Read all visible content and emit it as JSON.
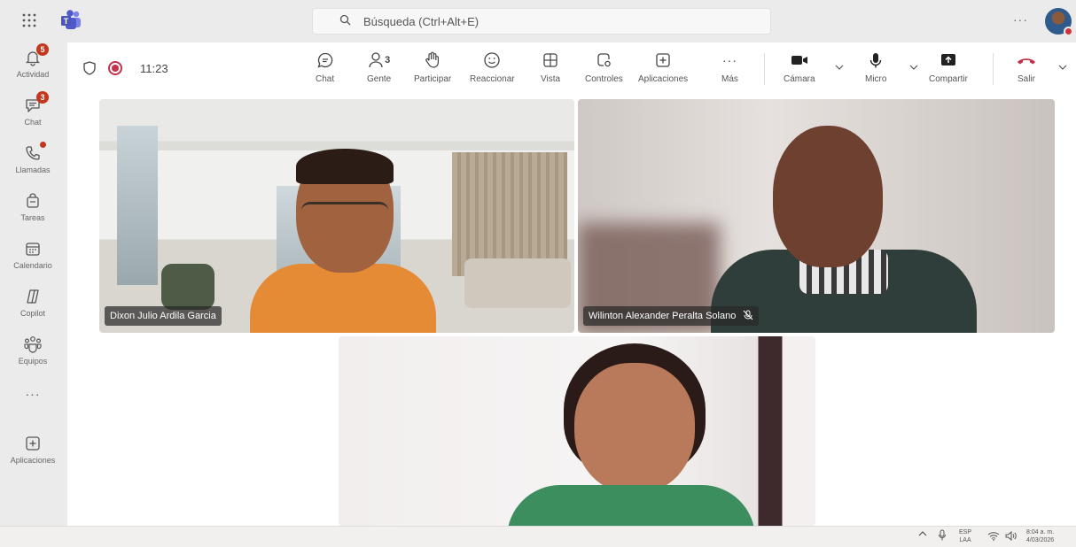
{
  "topbar": {
    "search_placeholder": "Búsqueda (Ctrl+Alt+E)",
    "more": "···",
    "icons": [
      "app-grid-icon",
      "teams-logo-icon",
      "search-icon"
    ]
  },
  "rail": {
    "items": [
      {
        "label": "Actividad",
        "badge": "5",
        "icon": "bell-icon"
      },
      {
        "label": "Chat",
        "badge": "3",
        "icon": "chat-icon"
      },
      {
        "label": "Llamadas",
        "dot": true,
        "icon": "phone-icon"
      },
      {
        "label": "Tareas",
        "icon": "tasks-icon"
      },
      {
        "label": "Calendario",
        "icon": "calendar-icon"
      },
      {
        "label": "Copilot",
        "icon": "copilot-icon"
      },
      {
        "label": "Equipos",
        "icon": "teams-icon"
      },
      {
        "label": "···",
        "icon": "more-icon"
      },
      {
        "label": "Aplicaciones",
        "icon": "apps-add-icon"
      }
    ]
  },
  "toolbar": {
    "timer": "11:23",
    "buttons": {
      "chat": "Chat",
      "people": "Gente",
      "people_count": "3",
      "raise": "Participar",
      "react": "Reaccionar",
      "view": "Vista",
      "controls": "Controles",
      "apps": "Aplicaciones",
      "more": "Más",
      "camera": "Cámara",
      "mic": "Micro",
      "share": "Compartir",
      "leave": "Salir"
    },
    "more_dots": "···",
    "colors": {
      "record": "#c4314b",
      "leave": "#c4314b"
    }
  },
  "participants": [
    {
      "name": "Dixon Julio Ardila Garcia",
      "muted": false
    },
    {
      "name": "Wilinton Alexander Peralta Solano",
      "muted": true
    },
    {
      "name": "",
      "muted": false
    }
  ],
  "taskbar": {
    "lang_top": "ESP",
    "lang_bottom": "LAA",
    "time": "8:04 a. m.",
    "date": "4/03/2026"
  }
}
